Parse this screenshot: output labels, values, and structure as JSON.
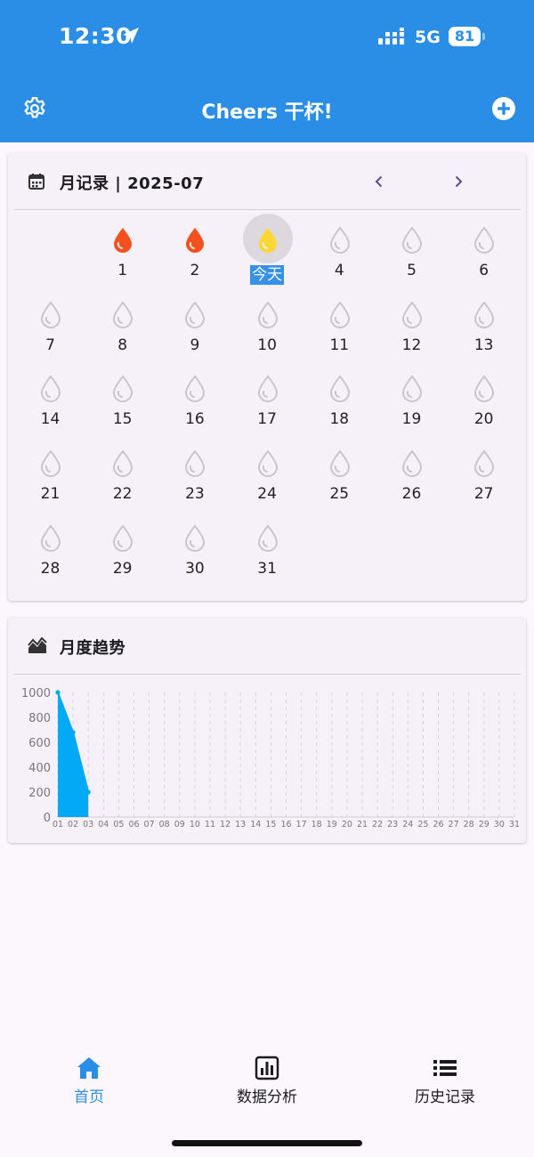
{
  "status_bar": {
    "time": "12:30",
    "network": "5G",
    "battery": "81"
  },
  "app_bar": {
    "title": "Cheers 干杯!"
  },
  "calendar": {
    "title": "月记录 | 2025-07",
    "prev_label": "‹",
    "next_label": "›",
    "start_weekday": 1,
    "days": [
      {
        "label": "1",
        "state": "record-high"
      },
      {
        "label": "2",
        "state": "record-high"
      },
      {
        "label": "今天",
        "state": "today-low"
      },
      {
        "label": "4",
        "state": "empty"
      },
      {
        "label": "5",
        "state": "empty"
      },
      {
        "label": "6",
        "state": "empty"
      },
      {
        "label": "7",
        "state": "empty"
      },
      {
        "label": "8",
        "state": "empty"
      },
      {
        "label": "9",
        "state": "empty"
      },
      {
        "label": "10",
        "state": "empty"
      },
      {
        "label": "11",
        "state": "empty"
      },
      {
        "label": "12",
        "state": "empty"
      },
      {
        "label": "13",
        "state": "empty"
      },
      {
        "label": "14",
        "state": "empty"
      },
      {
        "label": "15",
        "state": "empty"
      },
      {
        "label": "16",
        "state": "empty"
      },
      {
        "label": "17",
        "state": "empty"
      },
      {
        "label": "18",
        "state": "empty"
      },
      {
        "label": "19",
        "state": "empty"
      },
      {
        "label": "20",
        "state": "empty"
      },
      {
        "label": "21",
        "state": "empty"
      },
      {
        "label": "22",
        "state": "empty"
      },
      {
        "label": "23",
        "state": "empty"
      },
      {
        "label": "24",
        "state": "empty"
      },
      {
        "label": "25",
        "state": "empty"
      },
      {
        "label": "26",
        "state": "empty"
      },
      {
        "label": "27",
        "state": "empty"
      },
      {
        "label": "28",
        "state": "empty"
      },
      {
        "label": "29",
        "state": "empty"
      },
      {
        "label": "30",
        "state": "empty"
      },
      {
        "label": "31",
        "state": "empty"
      }
    ],
    "colors": {
      "high": "#f4511e",
      "low": "#fdd835",
      "empty": "#c9c5cc",
      "today_bg": "#3590e6"
    }
  },
  "trend": {
    "title": "月度趋势",
    "chart_data": {
      "type": "area",
      "x": [
        "01",
        "02",
        "03",
        "04",
        "05",
        "06",
        "07",
        "08",
        "09",
        "10",
        "11",
        "12",
        "13",
        "14",
        "15",
        "16",
        "17",
        "18",
        "19",
        "20",
        "21",
        "22",
        "23",
        "24",
        "25",
        "26",
        "27",
        "28",
        "29",
        "30",
        "31"
      ],
      "values": [
        1000,
        680,
        200
      ],
      "yticks": [
        0,
        200,
        400,
        600,
        800,
        1000
      ],
      "ylim": [
        0,
        1000
      ],
      "xlabel": "",
      "ylabel": "",
      "grid": "vertical-dashed",
      "color": "#03a9f4"
    }
  },
  "bottom_nav": {
    "items": [
      {
        "label": "首页",
        "icon": "home-icon",
        "active": true
      },
      {
        "label": "数据分析",
        "icon": "bar-chart-icon",
        "active": false
      },
      {
        "label": "历史记录",
        "icon": "list-icon",
        "active": false
      }
    ],
    "active_color": "#2a8de6"
  }
}
